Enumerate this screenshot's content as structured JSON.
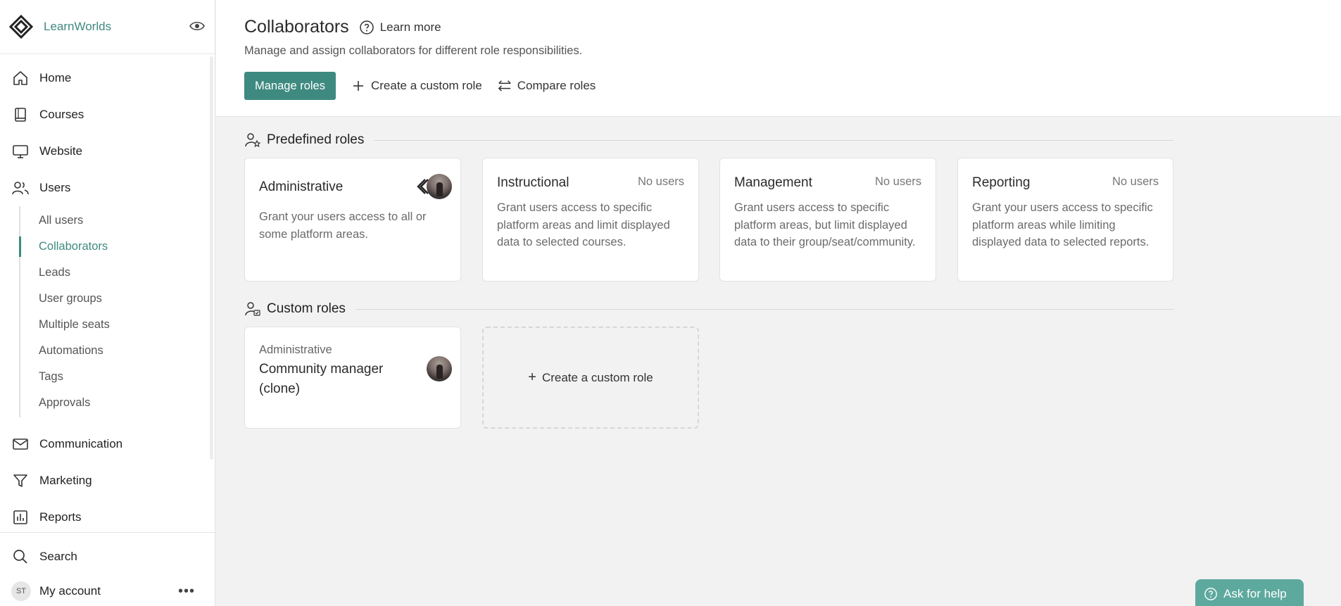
{
  "brand": {
    "name": "LearnWorlds"
  },
  "sidebar": {
    "items": [
      {
        "label": "Home",
        "icon": "home-icon"
      },
      {
        "label": "Courses",
        "icon": "book-icon"
      },
      {
        "label": "Website",
        "icon": "monitor-icon"
      },
      {
        "label": "Users",
        "icon": "users-icon"
      }
    ],
    "users_sub": [
      {
        "label": "All users"
      },
      {
        "label": "Collaborators",
        "active": true
      },
      {
        "label": "Leads"
      },
      {
        "label": "User groups"
      },
      {
        "label": "Multiple seats"
      },
      {
        "label": "Automations"
      },
      {
        "label": "Tags"
      },
      {
        "label": "Approvals"
      }
    ],
    "items_after": [
      {
        "label": "Communication",
        "icon": "mail-icon"
      },
      {
        "label": "Marketing",
        "icon": "funnel-icon"
      },
      {
        "label": "Reports",
        "icon": "chart-icon"
      }
    ],
    "search_label": "Search",
    "account": {
      "initials": "ST",
      "label": "My account"
    }
  },
  "header": {
    "title": "Collaborators",
    "learn_more": "Learn more",
    "subtitle": "Manage and assign collaborators for different role responsibilities.",
    "manage_roles": "Manage roles",
    "create_custom_role": "Create a custom role",
    "compare_roles": "Compare roles"
  },
  "predefined": {
    "heading": "Predefined roles",
    "cards": [
      {
        "title": "Administrative",
        "count": "",
        "desc": "Grant your users access to all or some platform areas."
      },
      {
        "title": "Instructional",
        "count": "No users",
        "desc": "Grant users access to specific platform areas and limit displayed data to selected courses."
      },
      {
        "title": "Management",
        "count": "No users",
        "desc": "Grant users access to specific platform areas, but limit displayed data to their group/seat/community."
      },
      {
        "title": "Reporting",
        "count": "No users",
        "desc": "Grant your users access to specific platform areas while limiting displayed data to selected reports."
      }
    ]
  },
  "custom": {
    "heading": "Custom roles",
    "card": {
      "type": "Administrative",
      "title": "Community manager (clone)"
    },
    "create_label": "Create a custom role"
  },
  "help": {
    "label": "Ask for help"
  },
  "colors": {
    "accent": "#3e8a80",
    "help": "#5ea99e"
  }
}
